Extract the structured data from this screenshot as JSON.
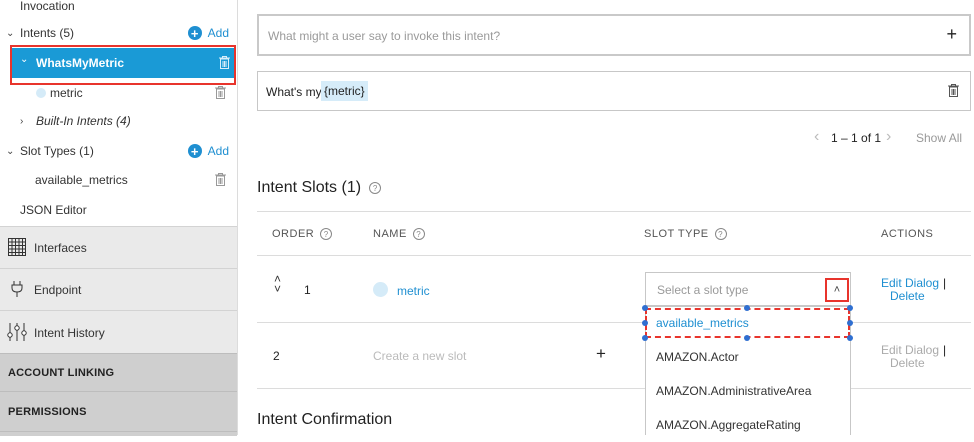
{
  "sidebar": {
    "invocation": "Invocation",
    "intents_label": "Intents (5)",
    "add_label": "Add",
    "selected_intent": "WhatsMyMetric",
    "slot_metric": "metric",
    "builtin_intents": "Built-In Intents (4)",
    "slot_types_label": "Slot Types (1)",
    "slot_type_item": "available_metrics",
    "json_editor": "JSON Editor",
    "interfaces": "Interfaces",
    "endpoint": "Endpoint",
    "intent_history": "Intent History",
    "account_linking": "ACCOUNT LINKING",
    "permissions": "PERMISSIONS"
  },
  "main": {
    "utterance_placeholder": "What might a user say to invoke this intent?",
    "utterance_text": "What's my",
    "utterance_slot": "{metric}",
    "pagination": "1 – 1 of 1",
    "show_all": "Show All",
    "slots_title": "Intent Slots (1)",
    "columns": {
      "order": "ORDER",
      "name": "NAME",
      "slot_type": "SLOT TYPE",
      "actions": "ACTIONS"
    },
    "row1": {
      "order": "1",
      "name": "metric",
      "slot_type_placeholder": "Select a slot type"
    },
    "row2": {
      "order": "2",
      "name_placeholder": "Create a new slot"
    },
    "edit_dialog": "Edit Dialog",
    "delete": "Delete",
    "separator": "|",
    "dropdown_options": [
      "available_metrics",
      "AMAZON.Actor",
      "AMAZON.AdministrativeArea",
      "AMAZON.AggregateRating"
    ],
    "confirmation_title": "Intent Confirmation"
  },
  "colors": {
    "accent": "#1f8fd1",
    "selected_bg": "#1a9ad6",
    "highlight": "#e8342c"
  }
}
